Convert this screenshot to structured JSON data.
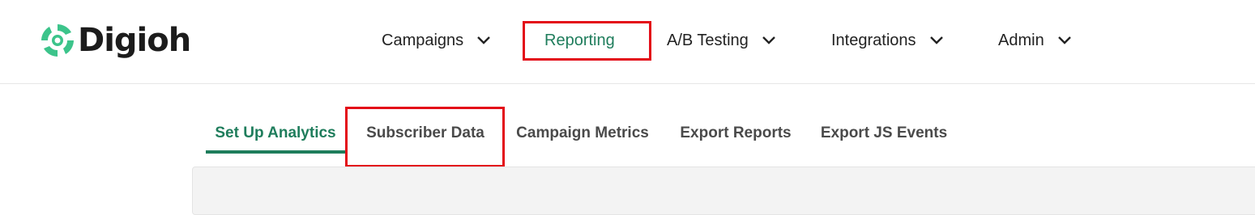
{
  "brand": {
    "name": "Digioh",
    "logo_icon": "digioh-swirl-icon",
    "accent_color": "#3cc48b"
  },
  "nav": {
    "items": [
      {
        "label": "Campaigns",
        "has_dropdown": true
      },
      {
        "label": "Reporting",
        "has_dropdown": false,
        "active": true
      },
      {
        "label": "A/B Testing",
        "has_dropdown": true
      },
      {
        "label": "Integrations",
        "has_dropdown": true
      },
      {
        "label": "Admin",
        "has_dropdown": true
      }
    ]
  },
  "subnav": {
    "tabs": [
      {
        "label": "Set Up Analytics",
        "active": true
      },
      {
        "label": "Subscriber Data"
      },
      {
        "label": "Campaign Metrics"
      },
      {
        "label": "Export Reports"
      },
      {
        "label": "Export JS Events"
      }
    ]
  },
  "colors": {
    "active_green": "#1f7d5c",
    "highlight_red": "#e30b17"
  }
}
